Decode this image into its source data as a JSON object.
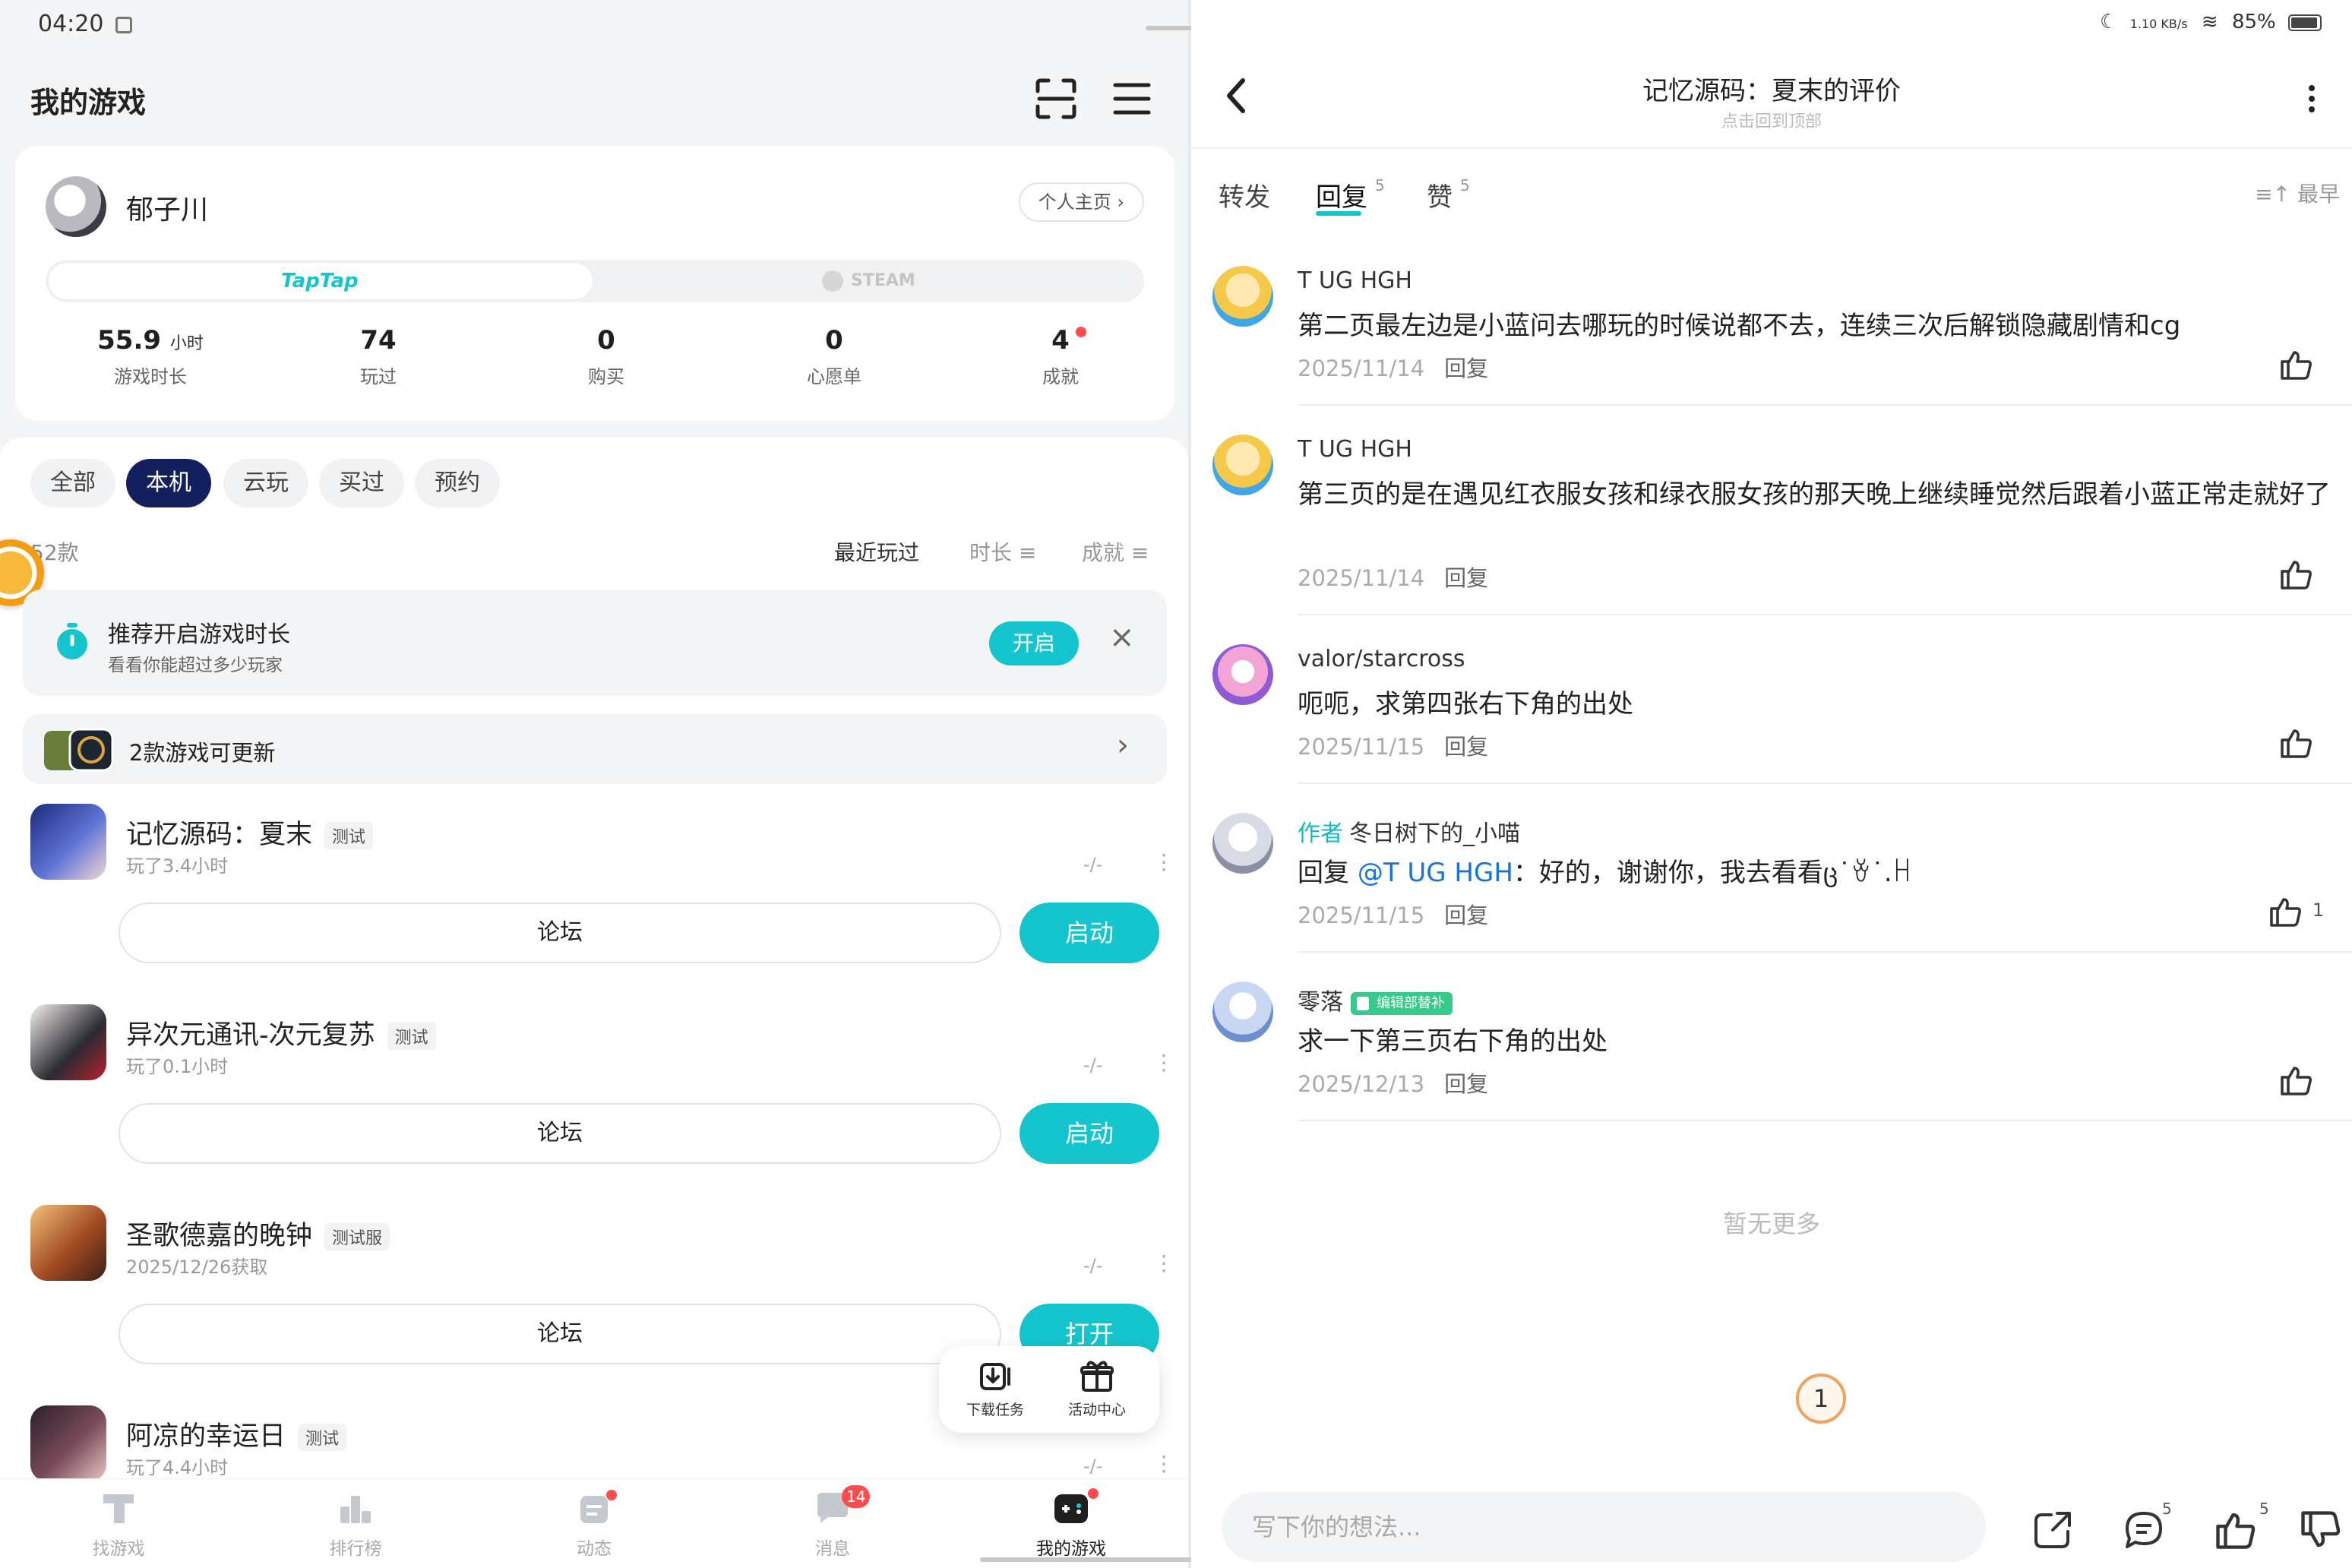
{
  "left": {
    "status_time": "04:20",
    "title": "我的游戏",
    "profile": {
      "username": "郁子川",
      "homepage_btn": "个人主页 ›",
      "platforms": [
        "TapTap",
        "STEAM"
      ],
      "stats": [
        {
          "value": "55.9",
          "unit": "小时",
          "label": "游戏时长"
        },
        {
          "value": "74",
          "unit": "",
          "label": "玩过"
        },
        {
          "value": "0",
          "unit": "",
          "label": "购买"
        },
        {
          "value": "0",
          "unit": "",
          "label": "心愿单"
        },
        {
          "value": "4",
          "unit": "",
          "label": "成就"
        }
      ]
    },
    "filters": [
      "全部",
      "本机",
      "云玩",
      "买过",
      "预约"
    ],
    "active_filter": "本机",
    "count": "52款",
    "sorts": [
      "最近玩过",
      "时长 ≡",
      "成就 ≡"
    ],
    "notice": {
      "title": "推荐开启游戏时长",
      "subtitle": "看看你能超过多少玩家",
      "enable": "开启",
      "close": "×"
    },
    "update": {
      "text": "2款游戏可更新",
      "chevron": "›"
    },
    "games": [
      {
        "title": "记忆源码：夏末",
        "badge": "测试",
        "sub": "玩了3.4小时",
        "slash": "-/-",
        "forum": "论坛",
        "action": "启动"
      },
      {
        "title": "异次元通讯-次元复苏",
        "badge": "测试",
        "sub": "玩了0.1小时",
        "slash": "-/-",
        "forum": "论坛",
        "action": "启动"
      },
      {
        "title": "圣歌德嘉的晚钟",
        "badge": "测试服",
        "sub": "2025/12/26获取",
        "slash": "-/-",
        "forum": "论坛",
        "action": "打开"
      },
      {
        "title": "阿凉的幸运日",
        "badge": "测试",
        "sub": "玩了4.4小时",
        "slash": "-/-"
      }
    ],
    "float_panel": [
      "下载任务",
      "活动中心"
    ],
    "nav": [
      {
        "label": "找游戏"
      },
      {
        "label": "排行榜"
      },
      {
        "label": "动态"
      },
      {
        "label": "消息",
        "badge": "14"
      },
      {
        "label": "我的游戏"
      }
    ]
  },
  "right": {
    "status": {
      "speed": "1.10 KB/s",
      "battery": "85%"
    },
    "title": "记忆源码：夏末的评价",
    "subtitle": "点击回到顶部",
    "tabs": [
      {
        "label": "转发",
        "count": ""
      },
      {
        "label": "回复",
        "count": "5"
      },
      {
        "label": "赞",
        "count": "5"
      }
    ],
    "sort": "最早",
    "comments": [
      {
        "author": "T UG HGH",
        "text": "第二页最左边是小蓝问去哪玩的时候说都不去，连续三次后解锁隐藏剧情和cg",
        "date": "2025/11/14",
        "reply": "回复",
        "likes": ""
      },
      {
        "author": "T UG HGH",
        "text": "第三页的是在遇见红衣服女孩和绿衣服女孩的那天晚上继续睡觉然后跟着小蓝正常走就好了",
        "date": "2025/11/14",
        "reply": "回复",
        "likes": ""
      },
      {
        "author": "valor/starcross",
        "text": "呃呃，求第四张右下角的出处",
        "date": "2025/11/15",
        "reply": "回复",
        "likes": ""
      },
      {
        "author": "冬日树下的_小喵",
        "author_tag": "作者",
        "text_prefix": "回复 ",
        "mention": "@T UG HGH",
        "text": "：好的，谢谢你，我去看看ც˙ꈊ˙.ꀿ",
        "date": "2025/11/15",
        "reply": "回复",
        "likes": "1"
      },
      {
        "author": "零落",
        "role_tag": "编辑部替补",
        "text": "求一下第三页右下角的出处",
        "date": "2025/12/13",
        "reply": "回复",
        "likes": ""
      }
    ],
    "no_more": "暂无更多",
    "page_counter": "1",
    "reply_placeholder": "写下你的想法...",
    "action_counts": {
      "comments": "5",
      "likes": "5"
    }
  },
  "colors": {
    "accent": "#15c5ce",
    "navy": "#14205e",
    "badge_red": "#ff4d4f"
  }
}
